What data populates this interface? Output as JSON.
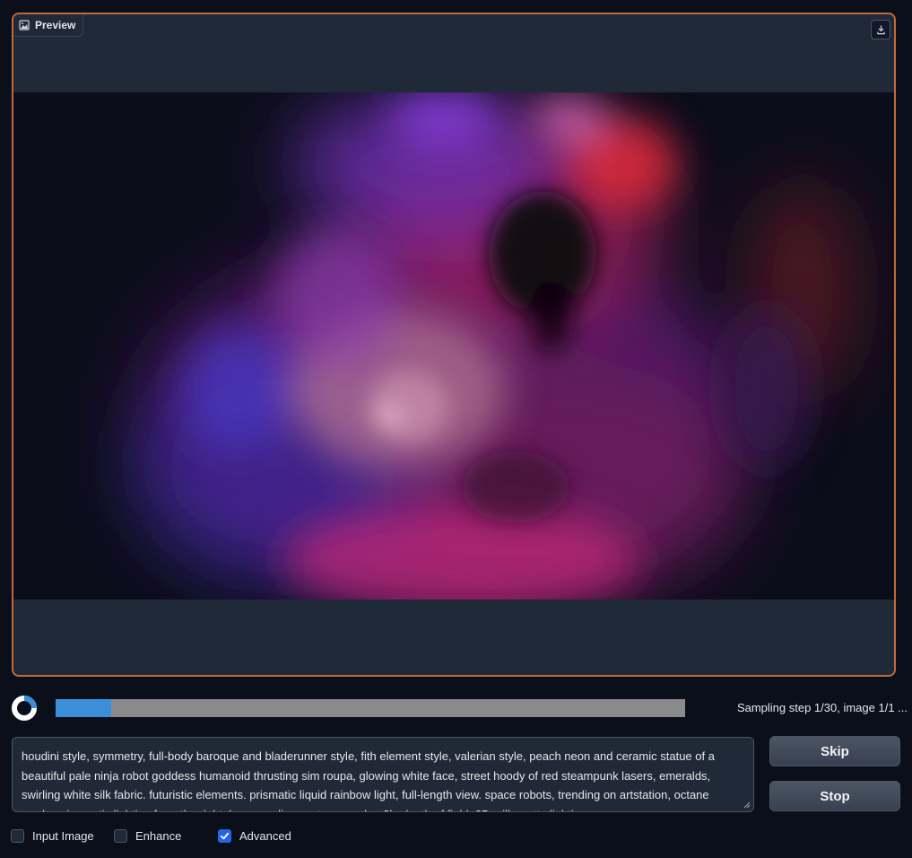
{
  "preview": {
    "label": "Preview",
    "icons": {
      "label_icon": "image-icon",
      "download": "download-icon"
    }
  },
  "progress": {
    "value": 0.088,
    "text": "Sampling step 1/30, image 1/1 ..."
  },
  "prompt": {
    "text": "houdini style, symmetry, full-body baroque and bladerunner style, fith element style, valerian style, peach neon and ceramic statue of a beautiful pale ninja robot goddess humanoid thrusting sim roupa, glowing white face, street hoody of red steampunk lasers, emeralds, swirling white silk fabric. futuristic elements. prismatic liquid rainbow light, full-length view. space robots, trending on artstation, octane render, cinematic lighting from the right, hyper realism, octane render, 8k, depth of field, 3D, silhouette lighting"
  },
  "buttons": {
    "skip": "Skip",
    "stop": "Stop"
  },
  "options": [
    {
      "label": "Input Image",
      "checked": false
    },
    {
      "label": "Enhance",
      "checked": false
    },
    {
      "label": "Advanced",
      "checked": true
    }
  ],
  "colors": {
    "accent": "#c26a35",
    "progress": "#3b8fd9",
    "checkbox_checked": "#2563eb",
    "background": "#0b0f19"
  }
}
